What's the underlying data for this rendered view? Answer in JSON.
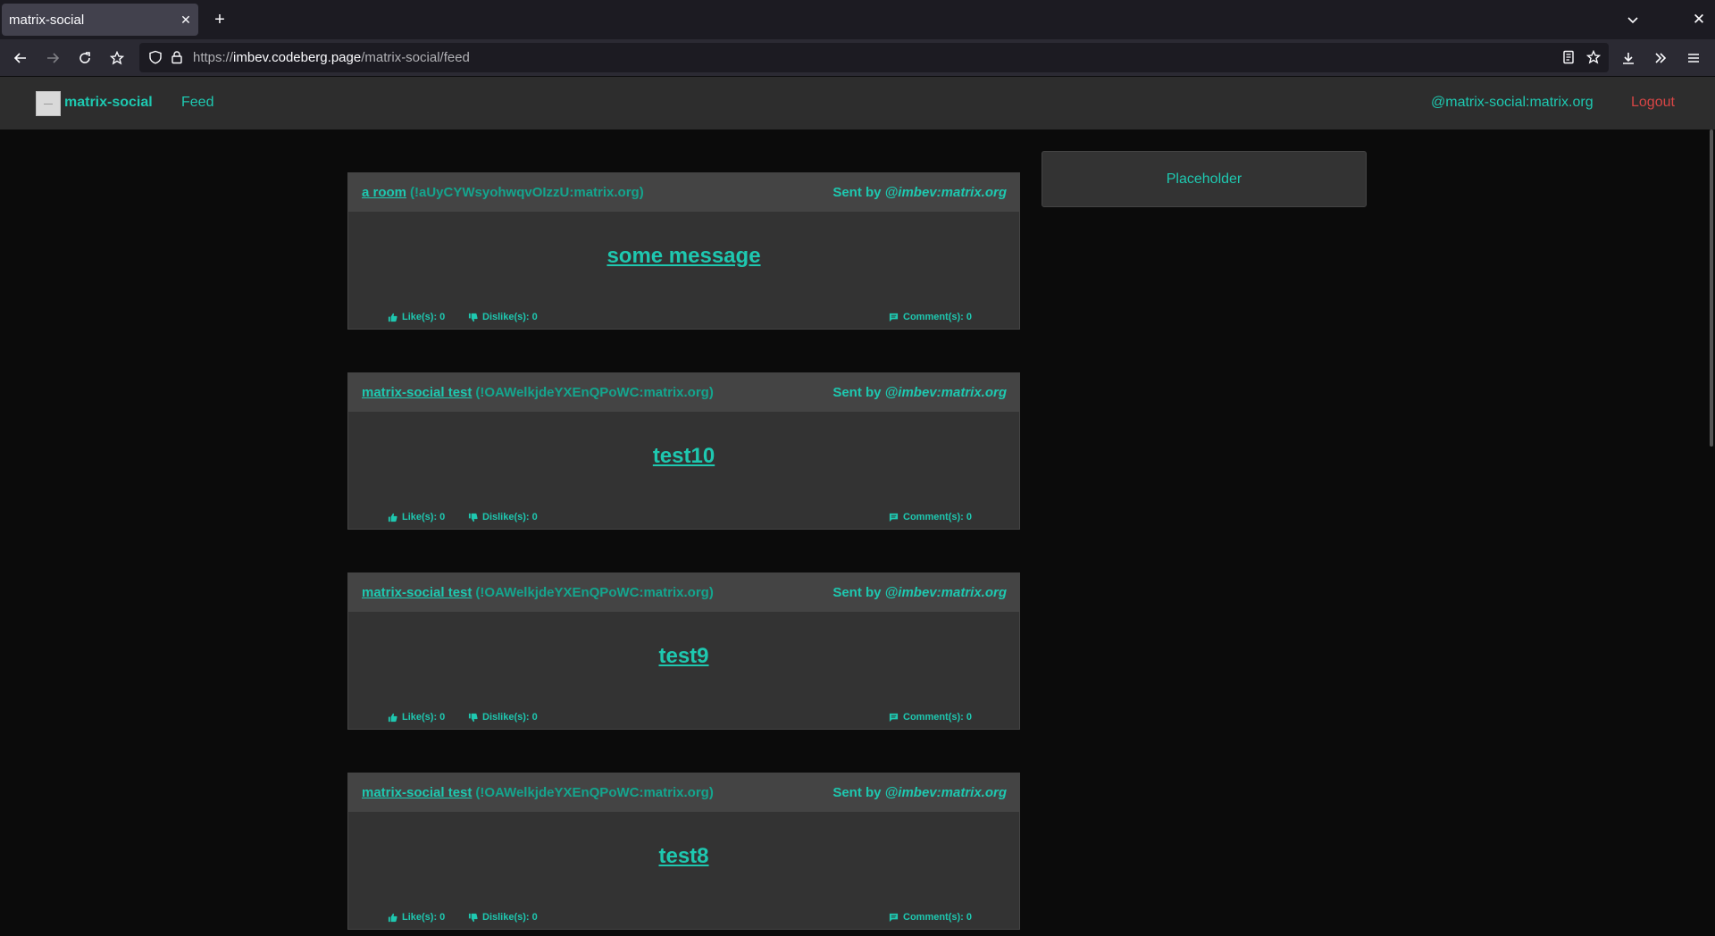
{
  "browser": {
    "tab_title": "matrix-social",
    "url_host": "imbev.codeberg.page",
    "url_scheme": "https://",
    "url_path": "/matrix-social/feed"
  },
  "header": {
    "brand": "matrix-social",
    "nav_feed": "Feed",
    "user_id": "@matrix-social:matrix.org",
    "logout": "Logout"
  },
  "sidebar": {
    "placeholder": "Placeholder"
  },
  "posts": [
    {
      "room_name": "a room",
      "room_id": "(!aUyCYWsyohwqvOIzzU:matrix.org)",
      "sent_by_label": "Sent by",
      "sender": "@imbev:matrix.org",
      "message": "some message",
      "likes": "Like(s): 0",
      "dislikes": "Dislike(s): 0",
      "comments": "Comment(s): 0"
    },
    {
      "room_name": "matrix-social test",
      "room_id": "(!OAWelkjdeYXEnQPoWC:matrix.org)",
      "sent_by_label": "Sent by",
      "sender": "@imbev:matrix.org",
      "message": "test10",
      "likes": "Like(s): 0",
      "dislikes": "Dislike(s): 0",
      "comments": "Comment(s): 0"
    },
    {
      "room_name": "matrix-social test",
      "room_id": "(!OAWelkjdeYXEnQPoWC:matrix.org)",
      "sent_by_label": "Sent by",
      "sender": "@imbev:matrix.org",
      "message": "test9",
      "likes": "Like(s): 0",
      "dislikes": "Dislike(s): 0",
      "comments": "Comment(s): 0"
    },
    {
      "room_name": "matrix-social test",
      "room_id": "(!OAWelkjdeYXEnQPoWC:matrix.org)",
      "sent_by_label": "Sent by",
      "sender": "@imbev:matrix.org",
      "message": "test8",
      "likes": "Like(s): 0",
      "dislikes": "Dislike(s): 0",
      "comments": "Comment(s): 0"
    }
  ],
  "icons": {
    "like": "thumbs-up-icon",
    "dislike": "thumbs-down-icon",
    "comment": "comment-icon"
  },
  "colors": {
    "accent": "#1ec8b0",
    "logout": "#d64545",
    "page_bg": "#0b0b0b",
    "card_bg": "#333333",
    "card_head_bg": "#444444"
  }
}
